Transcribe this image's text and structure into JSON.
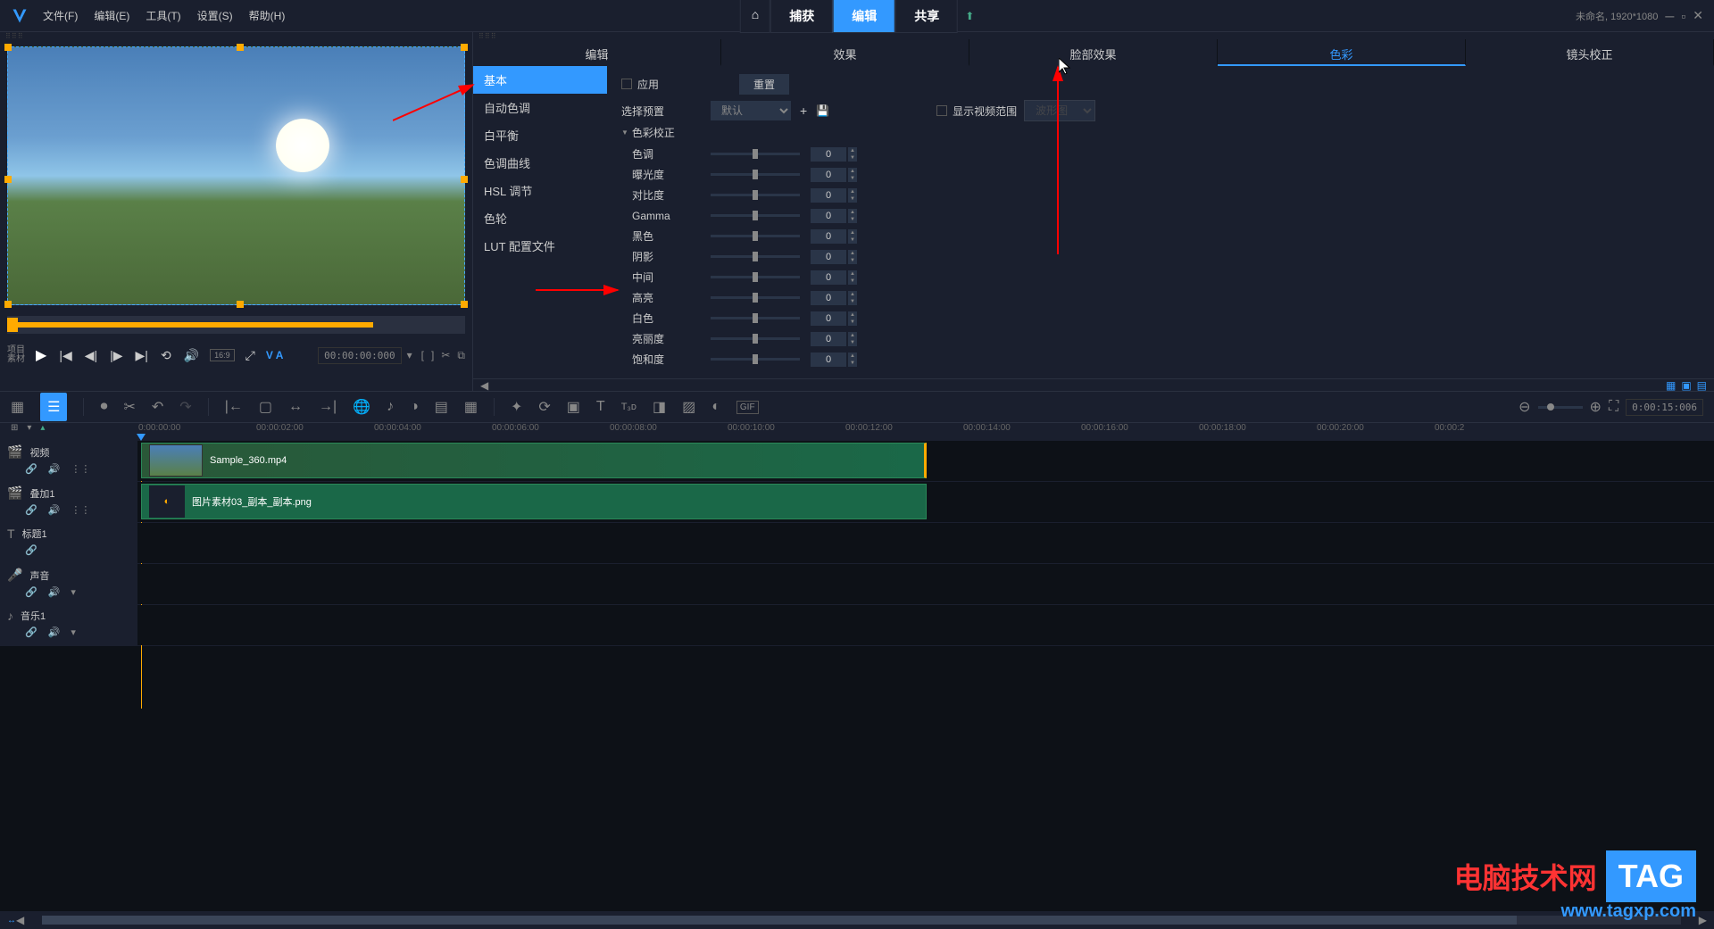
{
  "menu": {
    "file": "文件(F)",
    "edit": "编辑(E)",
    "tools": "工具(T)",
    "settings": "设置(S)",
    "help": "帮助(H)"
  },
  "topTabs": {
    "capture": "捕获",
    "edit": "编辑",
    "share": "共享"
  },
  "projectInfo": "未命名, 1920*1080",
  "preview": {
    "labelProject": "项目",
    "labelMaterial": "素材",
    "aspect": "16:9",
    "va": "V A",
    "timecode": "00:00:00:000"
  },
  "propTabs": {
    "edit": "编辑",
    "effects": "效果",
    "faceEffects": "脸部效果",
    "color": "色彩",
    "lensCorrection": "镜头校正"
  },
  "sidebar": {
    "basic": "基本",
    "autoTone": "自动色调",
    "whiteBalance": "白平衡",
    "toneCurve": "色调曲线",
    "hsl": "HSL 调节",
    "colorWheel": "色轮",
    "lut": "LUT 配置文件"
  },
  "params": {
    "apply": "应用",
    "reset": "重置",
    "selectPreset": "选择预置",
    "default": "默认",
    "showScope": "显示视频范围",
    "scopeType": "波形图",
    "sectionTitle": "色彩校正",
    "hue": "色调",
    "exposure": "曝光度",
    "contrast": "对比度",
    "gamma": "Gamma",
    "black": "黑色",
    "shadow": "阴影",
    "mid": "中间",
    "highlight": "高亮",
    "white": "白色",
    "vibrance": "亮丽度",
    "saturation": "饱和度",
    "value": "0"
  },
  "timeDisplay": "0:00:15:006",
  "ruler": [
    "0:00:00:00",
    "00:00:02:00",
    "00:00:04:00",
    "00:00:06:00",
    "00:00:08:00",
    "00:00:10:00",
    "00:00:12:00",
    "00:00:14:00",
    "00:00:16:00",
    "00:00:18:00",
    "00:00:20:00",
    "00:00:2"
  ],
  "tracks": {
    "video": "视频",
    "overlay": "叠加1",
    "title": "标题1",
    "sound": "声音",
    "music": "音乐1"
  },
  "clips": {
    "video": "Sample_360.mp4",
    "overlay": "图片素材03_副本_副本.png"
  },
  "watermark": {
    "text": "电脑技术网",
    "tag": "TAG",
    "url": "www.tagxp.com"
  }
}
